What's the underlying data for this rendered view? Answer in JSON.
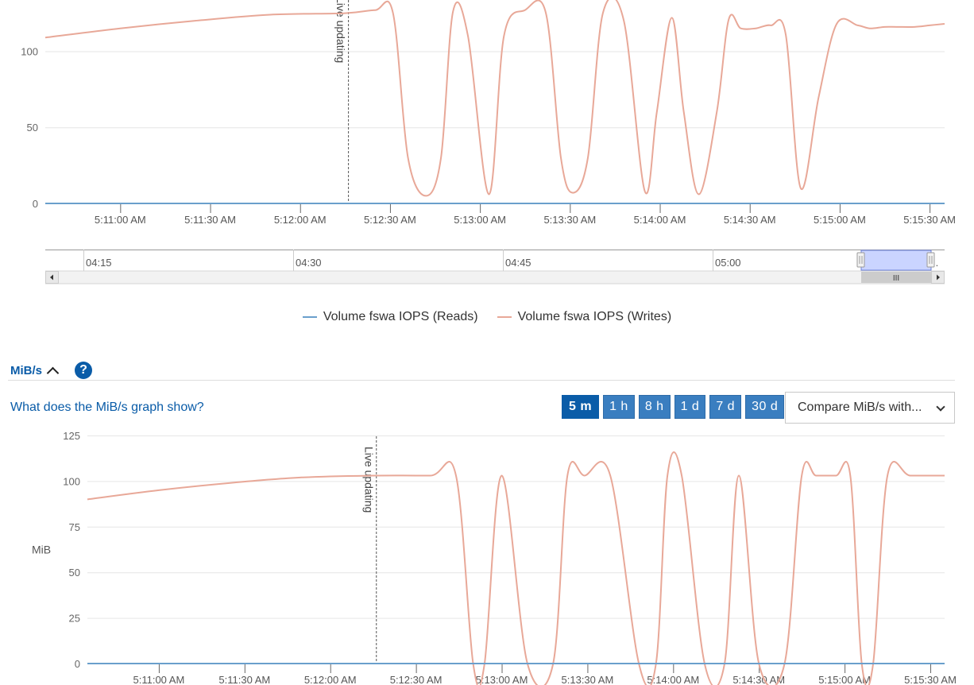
{
  "colors": {
    "reads": "#6a9fcc",
    "writes": "#e8a898",
    "accent": "#0a5ca8",
    "grid": "#e6e6e6"
  },
  "iops_chart": {
    "plot_band": "Live updating",
    "legend": [
      "Volume fswa IOPS (Reads)",
      "Volume fswa IOPS (Writes)"
    ],
    "navigator": {
      "ticks": [
        "04:15",
        "04:30",
        "04:45",
        "05:00"
      ],
      "scroll_grip": "III"
    }
  },
  "mib_section": {
    "title": "MiB/s",
    "help_icon": "question-circle-icon",
    "collapse_icon": "chevron-up-icon",
    "info_link": "What does the MiB/s graph show?",
    "range_buttons": [
      {
        "label": "5 m",
        "active": true
      },
      {
        "label": "1 h",
        "active": false
      },
      {
        "label": "8 h",
        "active": false
      },
      {
        "label": "1 d",
        "active": false
      },
      {
        "label": "7 d",
        "active": false
      },
      {
        "label": "30 d",
        "active": false
      }
    ],
    "compare_select": {
      "selected": "Compare MiB/s with..."
    }
  },
  "chart_data": [
    {
      "type": "line",
      "title": "",
      "ylabel": "",
      "xlim": [
        2.5,
        32.5
      ],
      "ylim": [
        0,
        130
      ],
      "y_ticks": [
        0,
        50,
        100
      ],
      "x_tick_values": [
        5,
        8,
        11,
        14,
        17,
        20,
        23,
        26,
        29,
        32
      ],
      "x_tick_labels": [
        "5:11:00 AM",
        "5:11:30 AM",
        "5:12:00 AM",
        "5:12:30 AM",
        "5:13:00 AM",
        "5:13:30 AM",
        "5:14:00 AM",
        "5:14:30 AM",
        "5:15:00 AM",
        "5:15:30 AM"
      ],
      "plot_line_x": 12.6,
      "series": [
        {
          "name": "Volume fswa IOPS (Reads)",
          "x": [
            2.5,
            32.5
          ],
          "values": [
            0,
            0
          ]
        },
        {
          "name": "Volume fswa IOPS (Writes)",
          "x": [
            2.5,
            5,
            7.5,
            10,
            12.5,
            13.5,
            14.1,
            14.6,
            15.2,
            15.7,
            16.1,
            16.6,
            17.3,
            17.8,
            18.5,
            19.2,
            19.7,
            20.1,
            20.6,
            21.1,
            21.8,
            22.5,
            22.9,
            23.4,
            23.8,
            24.3,
            24.9,
            25.3,
            25.7,
            26.2,
            26.7,
            27.2,
            27.7,
            28.3,
            28.9,
            29.6,
            30.0,
            30.5,
            30.9,
            31.5,
            32.0,
            32.5
          ],
          "values": [
            109,
            115,
            120,
            124,
            125,
            127,
            125,
            30,
            5,
            30,
            126,
            110,
            6,
            110,
            127,
            125,
            30,
            7,
            30,
            125,
            120,
            8,
            60,
            122,
            60,
            6,
            60,
            121,
            115,
            115,
            117,
            111,
            10,
            70,
            118,
            117,
            115,
            116,
            116,
            116,
            117,
            118
          ]
        }
      ]
    },
    {
      "type": "line",
      "title": "",
      "ylabel": "MiB",
      "xlim": [
        2.5,
        32.5
      ],
      "ylim": [
        0,
        125
      ],
      "y_ticks": [
        0,
        25,
        50,
        75,
        100,
        125
      ],
      "x_tick_values": [
        5,
        8,
        11,
        14,
        17,
        20,
        23,
        26,
        29,
        32
      ],
      "x_tick_labels": [
        "5:11:00 AM",
        "5:11:30 AM",
        "5:12:00 AM",
        "5:12:30 AM",
        "5:13:00 AM",
        "5:13:30 AM",
        "5:14:00 AM",
        "5:14:30 AM",
        "5:15:00 AM",
        "5:15:30 AM"
      ],
      "plot_line_x": 12.6,
      "series": [
        {
          "name": "Volume fswa IOPS (Reads)",
          "x": [
            2.5,
            32.5
          ],
          "values": [
            0,
            0
          ]
        },
        {
          "name": "Volume fswa IOPS (Writes)",
          "x": [
            2.5,
            5,
            7.5,
            10,
            12.5,
            14.5,
            15.4,
            16.0,
            16.4,
            17.0,
            17.9,
            18.8,
            19.3,
            19.9,
            20.8,
            21.8,
            22.4,
            22.8,
            23.3,
            24.1,
            24.8,
            25.3,
            26.0,
            26.9,
            27.5,
            28.0,
            28.7,
            29.2,
            29.6,
            30.0,
            30.5,
            31.3,
            32.5
          ],
          "values": [
            90,
            95,
            99,
            102,
            103,
            103,
            103,
            0,
            0,
            103,
            0,
            0,
            103,
            103,
            103,
            0,
            0,
            103,
            103,
            0,
            0,
            103,
            0,
            0,
            103,
            103,
            103,
            103,
            0,
            0,
            103,
            103,
            103
          ]
        }
      ]
    }
  ]
}
